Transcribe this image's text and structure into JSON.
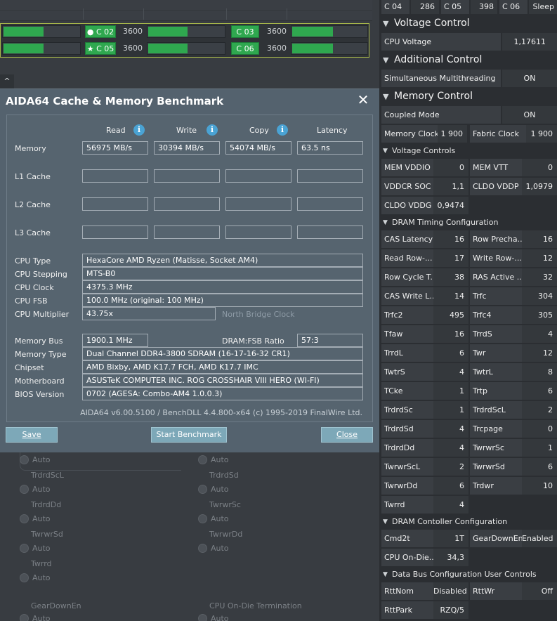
{
  "cores": {
    "row1": [
      {
        "label": "C 02",
        "icon": "dot-icon",
        "freq": "3600"
      },
      {
        "label": "C 03",
        "icon": "",
        "freq": "3600"
      }
    ],
    "row2": [
      {
        "label": "C 05",
        "icon": "star-icon",
        "freq": "3600"
      },
      {
        "label": "C 06",
        "icon": "",
        "freq": "3600"
      }
    ]
  },
  "minimize_glyph": "^",
  "background_fields": {
    "left": [
      "Auto",
      "TrdrdScL",
      "Auto",
      "TrdrdDd",
      "Auto",
      "TwrwrSd",
      "Auto",
      "Twrrd",
      "Auto",
      "GearDownEn",
      "Auto"
    ],
    "right": [
      "Auto",
      "TrdrdSd",
      "Auto",
      "TwrwrSc",
      "Auto",
      "TwrwrDd",
      "Auto",
      "CPU On-Die Termination",
      "Auto"
    ]
  },
  "right_panel": {
    "top_row": [
      {
        "label": "C 04",
        "value": "286"
      },
      {
        "label": "C 05",
        "value": "398"
      },
      {
        "label": "C 06",
        "value": "Sleep"
      }
    ],
    "voltage_control": {
      "title": "Voltage Control",
      "cpu_voltage_label": "CPU Voltage",
      "cpu_voltage_value": "1,17611"
    },
    "additional_control": {
      "title": "Additional Control",
      "smt_label": "Simultaneous Multithreading",
      "smt_value": "ON"
    },
    "memory_control": {
      "title": "Memory Control",
      "coupled_label": "Coupled Mode",
      "coupled_value": "ON",
      "memclk_label": "Memory Clock",
      "memclk_value": "1 900",
      "fclk_label": "Fabric Clock",
      "fclk_value": "1 900"
    },
    "voltage_controls": {
      "title": "Voltage Controls",
      "rows": [
        [
          {
            "label": "MEM VDDIO",
            "value": "0"
          },
          {
            "label": "MEM VTT",
            "value": "0"
          }
        ],
        [
          {
            "label": "VDDCR SOC",
            "value": "1,1"
          },
          {
            "label": "CLDO VDDP",
            "value": "1,0979"
          }
        ],
        [
          {
            "label": "CLDO VDDG",
            "value": "0,9474"
          }
        ]
      ]
    },
    "dram_timing": {
      "title": "DRAM Timing Configuration",
      "rows": [
        [
          {
            "label": "CAS Latency",
            "value": "16"
          },
          {
            "label": "Row Precha...",
            "value": "16"
          }
        ],
        [
          {
            "label": "Read Row-...",
            "value": "17"
          },
          {
            "label": "Write Row-...",
            "value": "12"
          }
        ],
        [
          {
            "label": "Row Cycle T...",
            "value": "38"
          },
          {
            "label": "RAS Active ...",
            "value": "32"
          }
        ],
        [
          {
            "label": "CAS Write L...",
            "value": "14"
          },
          {
            "label": "Trfc",
            "value": "304"
          }
        ],
        [
          {
            "label": "Trfc2",
            "value": "495"
          },
          {
            "label": "Trfc4",
            "value": "305"
          }
        ],
        [
          {
            "label": "Tfaw",
            "value": "16"
          },
          {
            "label": "TrrdS",
            "value": "4"
          }
        ],
        [
          {
            "label": "TrrdL",
            "value": "6"
          },
          {
            "label": "Twr",
            "value": "12"
          }
        ],
        [
          {
            "label": "TwtrS",
            "value": "4"
          },
          {
            "label": "TwtrL",
            "value": "8"
          }
        ],
        [
          {
            "label": "TCke",
            "value": "1"
          },
          {
            "label": "Trtp",
            "value": "6"
          }
        ],
        [
          {
            "label": "TrdrdSc",
            "value": "1"
          },
          {
            "label": "TrdrdScL",
            "value": "2"
          }
        ],
        [
          {
            "label": "TrdrdSd",
            "value": "4"
          },
          {
            "label": "Trcpage",
            "value": "0"
          }
        ],
        [
          {
            "label": "TrdrdDd",
            "value": "4"
          },
          {
            "label": "TwrwrSc",
            "value": "1"
          }
        ],
        [
          {
            "label": "TwrwrScL",
            "value": "2"
          },
          {
            "label": "TwrwrSd",
            "value": "6"
          }
        ],
        [
          {
            "label": "TwrwrDd",
            "value": "6"
          },
          {
            "label": "Trdwr",
            "value": "10"
          }
        ],
        [
          {
            "label": "Twrrd",
            "value": "4"
          }
        ]
      ]
    },
    "dram_controller": {
      "title": "DRAM Contoller Configuration",
      "rows": [
        [
          {
            "label": "Cmd2t",
            "value": "1T"
          },
          {
            "label": "GearDownEn",
            "value": "Enabled"
          }
        ],
        [
          {
            "label": "CPU On-Die...",
            "value": "34,3"
          }
        ]
      ]
    },
    "data_bus": {
      "title": "Data Bus Configuration User Controls",
      "rows": [
        [
          {
            "label": "RttNom",
            "value": "Disabled"
          },
          {
            "label": "RttWr",
            "value": "Off"
          }
        ],
        [
          {
            "label": "RttPark",
            "value": "RZQ/5"
          }
        ]
      ]
    }
  },
  "dialog": {
    "title": "AIDA64 Cache & Memory Benchmark",
    "close_glyph": "✕",
    "columns": [
      "Read",
      "Write",
      "Copy",
      "Latency"
    ],
    "info_glyph": "i",
    "rows": [
      {
        "label": "Memory",
        "values": [
          "56975 MB/s",
          "30394 MB/s",
          "54074 MB/s",
          "63.5 ns"
        ]
      },
      {
        "label": "L1 Cache",
        "values": [
          "",
          "",
          "",
          ""
        ]
      },
      {
        "label": "L2 Cache",
        "values": [
          "",
          "",
          "",
          ""
        ]
      },
      {
        "label": "L3 Cache",
        "values": [
          "",
          "",
          "",
          ""
        ]
      }
    ],
    "cpu": [
      {
        "label": "CPU Type",
        "value": "HexaCore AMD Ryzen  (Matisse, Socket AM4)"
      },
      {
        "label": "CPU Stepping",
        "value": "MTS-B0"
      },
      {
        "label": "CPU Clock",
        "value": "4375.3 MHz"
      },
      {
        "label": "CPU FSB",
        "value": "100.0 MHz  (original: 100 MHz)"
      },
      {
        "label": "CPU Multiplier",
        "value": "43.75x"
      }
    ],
    "north_bridge_label": "North Bridge Clock",
    "memory_bus_label": "Memory Bus",
    "memory_bus_value": "1900.1 MHz",
    "dram_fsb_label": "DRAM:FSB Ratio",
    "dram_fsb_value": "57:3",
    "system": [
      {
        "label": "Memory Type",
        "value": "Dual Channel DDR4-3800 SDRAM  (16-17-16-32 CR1)"
      },
      {
        "label": "Chipset",
        "value": "AMD Bixby, AMD K17.7 FCH, AMD K17.7 IMC"
      },
      {
        "label": "Motherboard",
        "value": "ASUSTeK COMPUTER INC. ROG CROSSHAIR VIII HERO (WI-FI)"
      },
      {
        "label": "BIOS Version",
        "value": "0702  (AGESA: Combo-AM4 1.0.0.3)"
      }
    ],
    "footer": "AIDA64 v6.00.5100 / BenchDLL 4.4.800-x64  (c) 1995-2019 FinalWire Ltd.",
    "buttons": {
      "save": "Save",
      "start": "Start Benchmark",
      "close": "Close"
    }
  }
}
